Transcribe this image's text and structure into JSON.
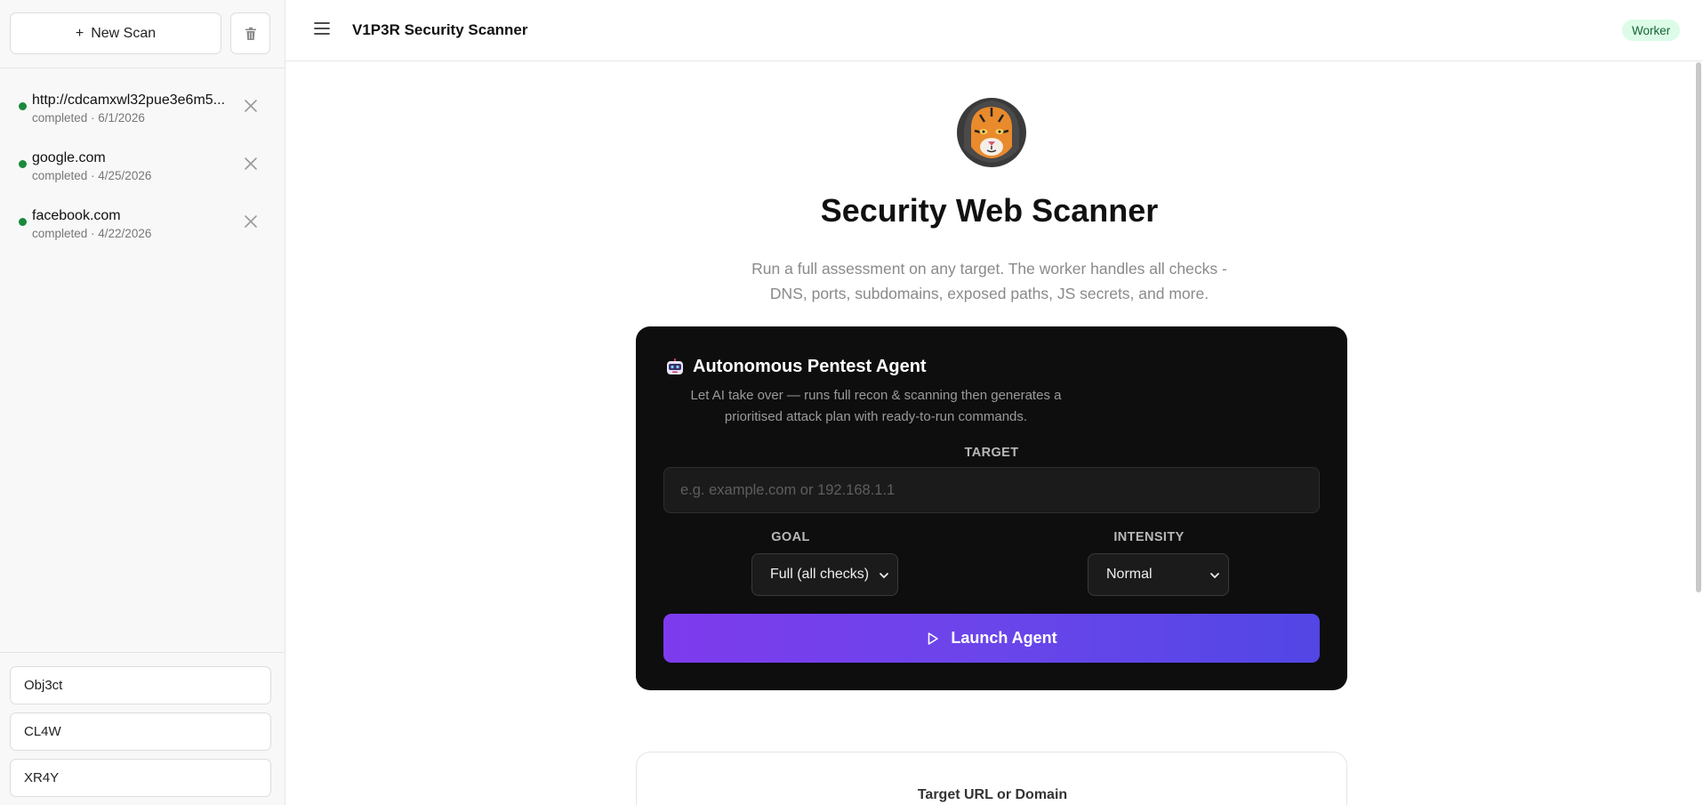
{
  "sidebar": {
    "new_scan_label": "New Scan",
    "scans": [
      {
        "title": "http://cdcamxwl32pue3e6m5...",
        "meta": "completed · 6/1/2026",
        "status_color": "#1a8a3c"
      },
      {
        "title": "google.com",
        "meta": "completed · 4/25/2026",
        "status_color": "#1a8a3c"
      },
      {
        "title": "facebook.com",
        "meta": "completed · 4/22/2026",
        "status_color": "#1a8a3c"
      }
    ],
    "agents": [
      "Obj3ct",
      "CL4W",
      "XR4Y"
    ]
  },
  "header": {
    "title": "V1P3R Security Scanner",
    "badge": "Worker"
  },
  "main": {
    "title": "Security Web Scanner",
    "description_line1": "Run a full assessment on any target. The worker handles all checks -",
    "description_line2": "DNS, ports, subdomains, exposed paths, JS secrets, and more."
  },
  "agent_card": {
    "title": "Autonomous Pentest Agent",
    "description_line1": "Let AI take over — runs full recon & scanning then generates a",
    "description_line2": "prioritised attack plan with ready-to-run commands.",
    "target_label": "TARGET",
    "target_placeholder": "e.g. example.com or 192.168.1.1",
    "goal_label": "GOAL",
    "goal_value": "Full (all checks)",
    "intensity_label": "INTENSITY",
    "intensity_value": "Normal",
    "launch_label": "Launch Agent"
  },
  "target_card": {
    "label": "Target URL or Domain"
  },
  "colors": {
    "accent_start": "#7e3bed",
    "accent_end": "#5246e5",
    "status_green": "#1a8a3c",
    "badge_bg": "#dcfce7",
    "badge_text": "#166534"
  }
}
